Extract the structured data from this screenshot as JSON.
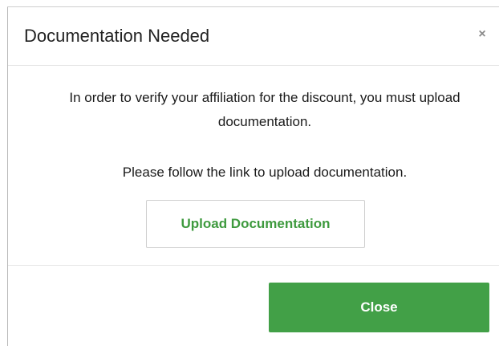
{
  "modal": {
    "title": "Documentation Needed",
    "close_icon_glyph": "×",
    "close_icon": "close-icon",
    "body": {
      "paragraph_1": "In order to verify your affiliation for the discount, you must upload documentation.",
      "paragraph_2": "Please follow the link to upload documentation.",
      "upload_button_label": "Upload Documentation"
    },
    "footer": {
      "close_button_label": "Close"
    }
  },
  "colors": {
    "accent_green": "#42a047",
    "link_green": "#3e9a3e",
    "text": "#1a1a1a",
    "border": "#e6e6e6"
  }
}
